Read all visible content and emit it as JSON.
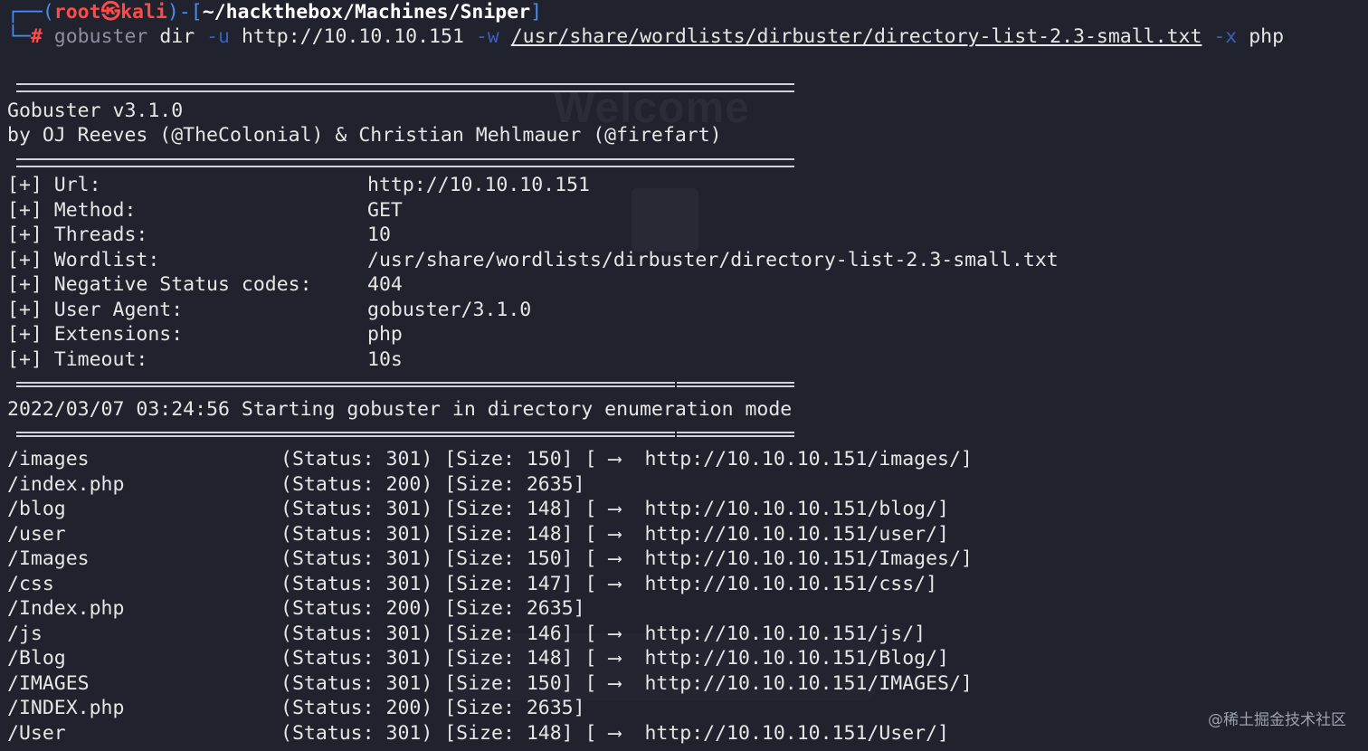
{
  "prompt": {
    "corner_top": "┌──(",
    "user": "root",
    "at": "㉿",
    "host": "kali",
    "mid": ")-[",
    "cwd": "~/hackthebox/Machines/Sniper",
    "close": "]",
    "corner_bottom": "└─",
    "hash": "#",
    "cmd": "gobuster",
    "sub": "dir",
    "flag_u": "-u",
    "url": "http://10.10.10.151",
    "flag_w": "-w",
    "wordlist": "/usr/share/wordlists/dirbuster/directory-list-2.3-small.txt",
    "flag_x": "-x",
    "ext": "php"
  },
  "banner": {
    "line1": "Gobuster v3.1.0",
    "line2": "by OJ Reeves (@TheColonial) & Christian Mehlmauer (@firefart)"
  },
  "config": [
    {
      "key": "[+] Url:",
      "value": "http://10.10.10.151"
    },
    {
      "key": "[+] Method:",
      "value": "GET"
    },
    {
      "key": "[+] Threads:",
      "value": "10"
    },
    {
      "key": "[+] Wordlist:",
      "value": "/usr/share/wordlists/dirbuster/directory-list-2.3-small.txt"
    },
    {
      "key": "[+] Negative Status codes:",
      "value": "404"
    },
    {
      "key": "[+] User Agent:",
      "value": "gobuster/3.1.0"
    },
    {
      "key": "[+] Extensions:",
      "value": "php"
    },
    {
      "key": "[+] Timeout:",
      "value": "10s"
    }
  ],
  "start_line": "2022/03/07 03:24:56 Starting gobuster in directory enumeration mode",
  "results": [
    {
      "path": "/images",
      "info": "(Status: 301) [Size: 150]",
      "redirect": "http://10.10.10.151/images/]"
    },
    {
      "path": "/index.php",
      "info": "(Status: 200) [Size: 2635]",
      "redirect": ""
    },
    {
      "path": "/blog",
      "info": "(Status: 301) [Size: 148]",
      "redirect": "http://10.10.10.151/blog/]"
    },
    {
      "path": "/user",
      "info": "(Status: 301) [Size: 148]",
      "redirect": "http://10.10.10.151/user/]"
    },
    {
      "path": "/Images",
      "info": "(Status: 301) [Size: 150]",
      "redirect": "http://10.10.10.151/Images/]"
    },
    {
      "path": "/css",
      "info": "(Status: 301) [Size: 147]",
      "redirect": "http://10.10.10.151/css/]"
    },
    {
      "path": "/Index.php",
      "info": "(Status: 200) [Size: 2635]",
      "redirect": ""
    },
    {
      "path": "/js",
      "info": "(Status: 301) [Size: 146]",
      "redirect": "http://10.10.10.151/js/]"
    },
    {
      "path": "/Blog",
      "info": "(Status: 301) [Size: 148]",
      "redirect": "http://10.10.10.151/Blog/]"
    },
    {
      "path": "/IMAGES",
      "info": "(Status: 301) [Size: 150]",
      "redirect": "http://10.10.10.151/IMAGES/]"
    },
    {
      "path": "/INDEX.php",
      "info": "(Status: 200) [Size: 2635]",
      "redirect": ""
    },
    {
      "path": "/User",
      "info": "(Status: 301) [Size: 148]",
      "redirect": "http://10.10.10.151/User/]"
    }
  ],
  "redirect_prefix": "[",
  "arrow": "⟶",
  "watermark": "@稀土掘金技术社区",
  "background_ghost_text": "Welcome",
  "colors": {
    "background": "#20232d",
    "prompt_blue": "#4a8cf0",
    "prompt_red": "#ff4a4a",
    "text": "#e6e6e6"
  }
}
